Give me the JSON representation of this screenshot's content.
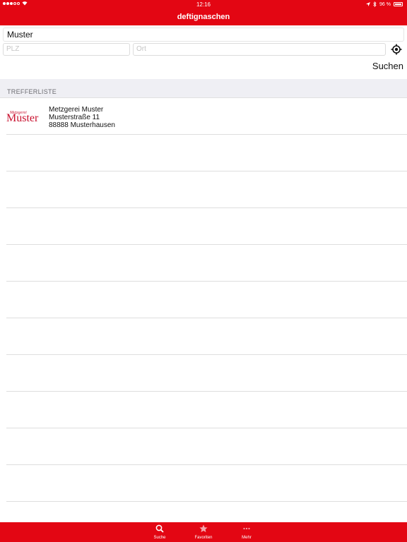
{
  "status_bar": {
    "time": "12:16",
    "battery_percent": 96,
    "battery_label": "96 %"
  },
  "header": {
    "title": "deftignaschen"
  },
  "search": {
    "query_value": "Muster",
    "plz_placeholder": "PLZ",
    "ort_placeholder": "Ort",
    "submit_label": "Suchen"
  },
  "results": {
    "header": "TREFFERLISTE",
    "items": [
      {
        "logo_text_small": "Metzgerei",
        "logo_text_large": "Muster",
        "name": "Metzgerei Muster",
        "street": "Musterstraße 11",
        "city": "88888 Musterhausen"
      }
    ]
  },
  "tabs": [
    {
      "label": "Suche",
      "icon": "search-icon"
    },
    {
      "label": "Favoriten",
      "icon": "star-icon"
    },
    {
      "label": "Mehr",
      "icon": "more-icon"
    }
  ],
  "colors": {
    "brand": "#e30613",
    "section_bg": "#efeff4",
    "divider": "#dedede"
  }
}
